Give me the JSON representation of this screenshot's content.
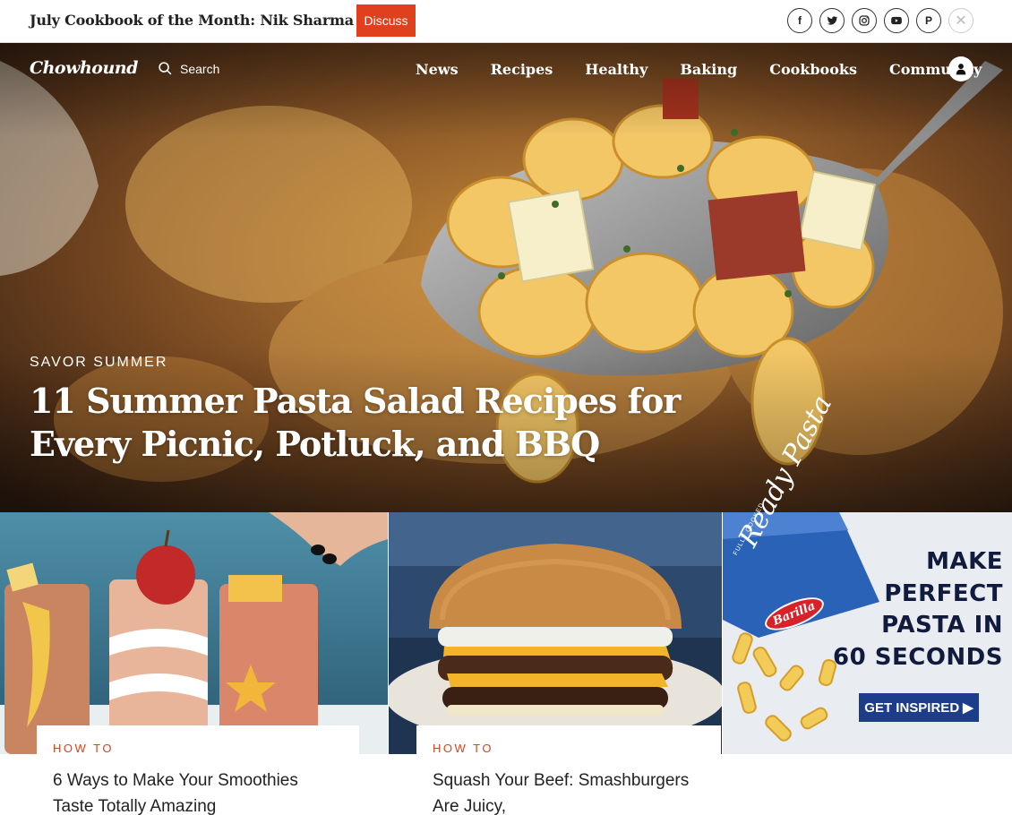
{
  "topbar": {
    "promo_text": "July Cookbook of the Month: Nik Sharma Month",
    "discuss_label": "Discuss",
    "socials": [
      {
        "icon": "facebook-icon",
        "glyph": "f"
      },
      {
        "icon": "twitter-icon",
        "glyph": ""
      },
      {
        "icon": "instagram-icon",
        "glyph": ""
      },
      {
        "icon": "youtube-icon",
        "glyph": ""
      },
      {
        "icon": "pinterest-icon",
        "glyph": "P"
      },
      {
        "icon": "close-icon",
        "glyph": "✕"
      }
    ]
  },
  "nav": {
    "logo": "Chowhound",
    "search_label": "Search",
    "items": [
      "News",
      "Recipes",
      "Healthy",
      "Baking",
      "Cookbooks",
      "Community"
    ]
  },
  "hero": {
    "kicker": "SAVOR SUMMER",
    "title": "11 Summer Pasta Salad Recipes for Every Picnic, Potluck, and BBQ"
  },
  "cards": [
    {
      "kicker": "HOW TO",
      "title": "6 Ways to Make Your Smoothies Taste Totally Amazing"
    },
    {
      "kicker": "HOW TO",
      "title": "Squash Your Beef: Smashburgers Are Juicy,"
    }
  ],
  "ad": {
    "lines": [
      "MAKE",
      "PERFECT",
      "PASTA IN",
      "60 SECONDS"
    ],
    "cta": "GET INSPIRED",
    "brand": "Barilla",
    "box_text": "Ready Pasta",
    "box_small": "FULLY COOKED"
  },
  "colors": {
    "accent": "#e0401c",
    "ad_navy": "#1d3c8a"
  }
}
